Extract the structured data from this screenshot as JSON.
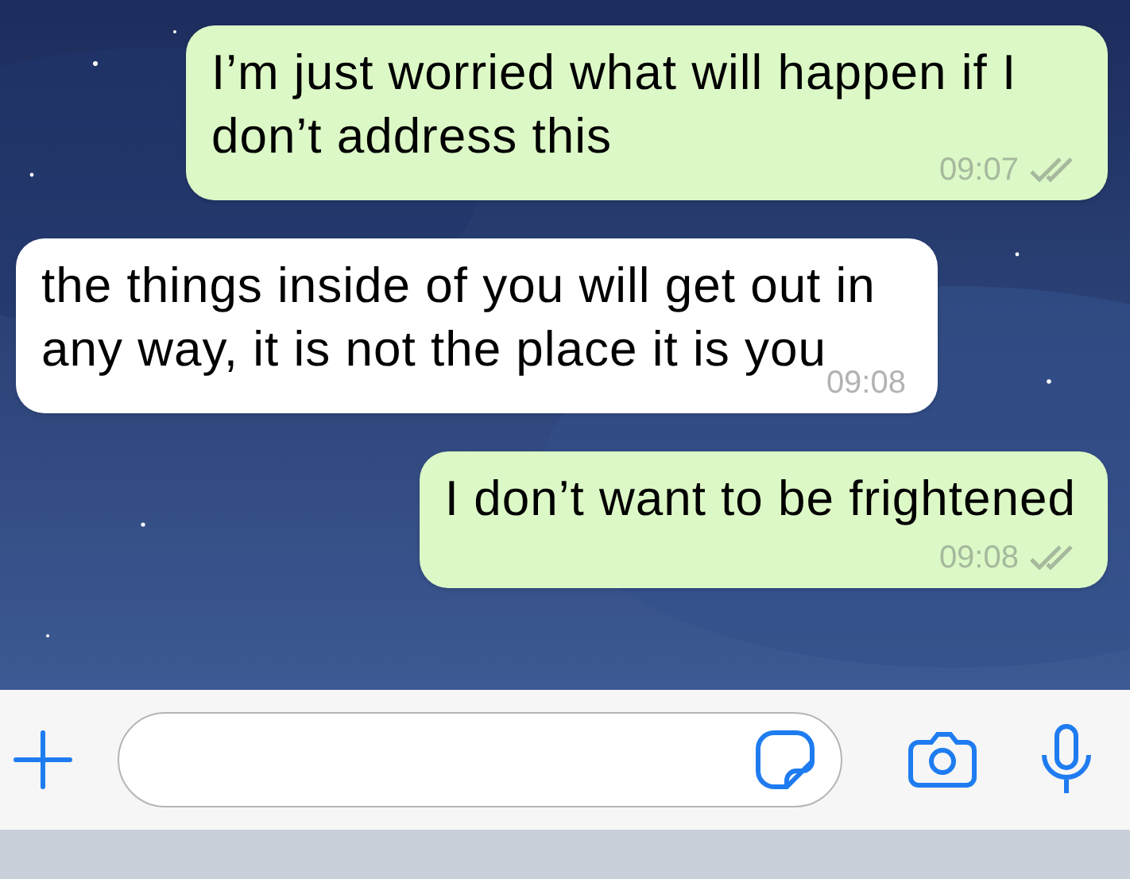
{
  "messages": [
    {
      "kind": "outgoing",
      "text": "I’m just worried what will happen if I don’t address this",
      "time": "09:07",
      "read": false
    },
    {
      "kind": "incoming",
      "text": "the things inside of you will get out in any way, it is not the place it is you",
      "time": "09:08"
    },
    {
      "kind": "outgoing",
      "text": "I don’t want to be frightened",
      "time": "09:08",
      "read": false
    }
  ]
}
